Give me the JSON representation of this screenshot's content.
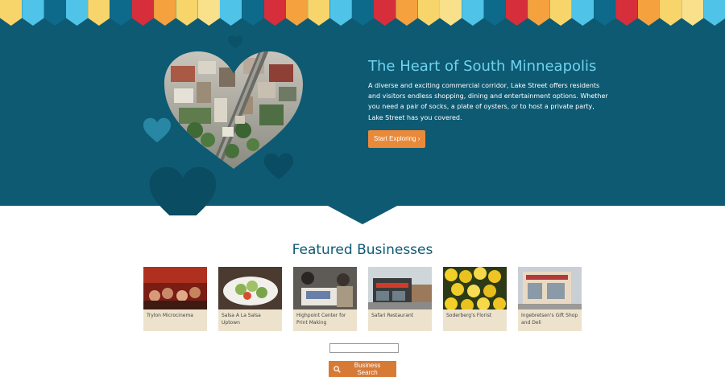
{
  "hero": {
    "title": "The Heart of South Minneapolis",
    "body": "A diverse and exciting commercial corridor, Lake Street offers residents and visitors endless shopping, dining and entertainment options. Whether you need a pair of socks, a plate of oysters, or to host a private party, Lake Street has you covered.",
    "cta_label": "Start Exploring ›"
  },
  "featured": {
    "title": "Featured Businesses",
    "businesses": [
      {
        "name": "Trylon Microcinema"
      },
      {
        "name": "Salsa A La Salsa Uptown"
      },
      {
        "name": "Highpoint Center for Print Making"
      },
      {
        "name": "Safari Restaurant"
      },
      {
        "name": "Soderberg's Florist"
      },
      {
        "name": "Ingebretsen's Gift Shop and Deli"
      }
    ]
  },
  "search": {
    "placeholder": "",
    "button_label": "Business Search"
  },
  "colors": {
    "hero_bg": "#0e5a73",
    "title_accent": "#6fd3ee",
    "cta": "#e98a3b",
    "card_bg": "#ede3cd",
    "bunting": [
      "#f7d56b",
      "#4fc3e8",
      "#0d6a8a",
      "#d62e3b",
      "#f4a13e",
      "#f9e08a"
    ]
  }
}
